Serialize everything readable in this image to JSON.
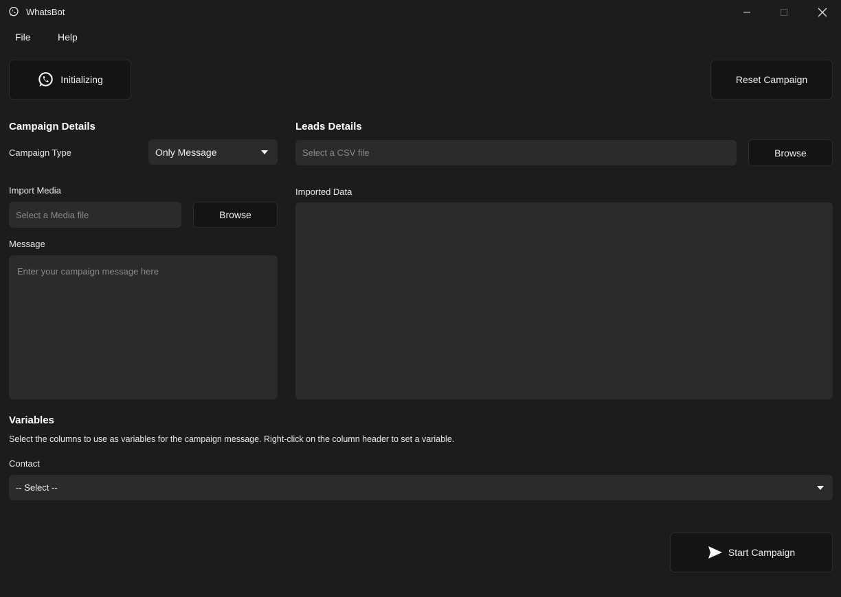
{
  "window": {
    "title": "WhatsBot",
    "icon": "whatsapp-icon",
    "controls": {
      "minimize": "–",
      "maximize": "□",
      "close": "✕"
    }
  },
  "menu": {
    "items": [
      "File",
      "Help"
    ]
  },
  "toolbar": {
    "status_label": "Initializing",
    "status_icon": "whatsapp-icon",
    "reset_label": "Reset Campaign"
  },
  "campaign": {
    "section_title": "Campaign Details",
    "type_label": "Campaign Type",
    "type_value": "Only Message",
    "media_label": "Import Media",
    "media_placeholder": "Select a Media file",
    "media_browse": "Browse",
    "message_label": "Message",
    "message_placeholder": "Enter your campaign message here"
  },
  "leads": {
    "section_title": "Leads Details",
    "csv_placeholder": "Select a CSV file",
    "csv_browse": "Browse",
    "imported_label": "Imported Data"
  },
  "variables": {
    "section_title": "Variables",
    "description": "Select the columns to use as variables for the campaign message. Right-click on the column header to set a variable.",
    "contact_label": "Contact",
    "contact_value": "-- Select --"
  },
  "actions": {
    "start_label": "Start Campaign",
    "start_icon": "send-icon"
  },
  "colors": {
    "background": "#1c1c1c",
    "field": "#2b2b2b",
    "button": "#141414"
  }
}
